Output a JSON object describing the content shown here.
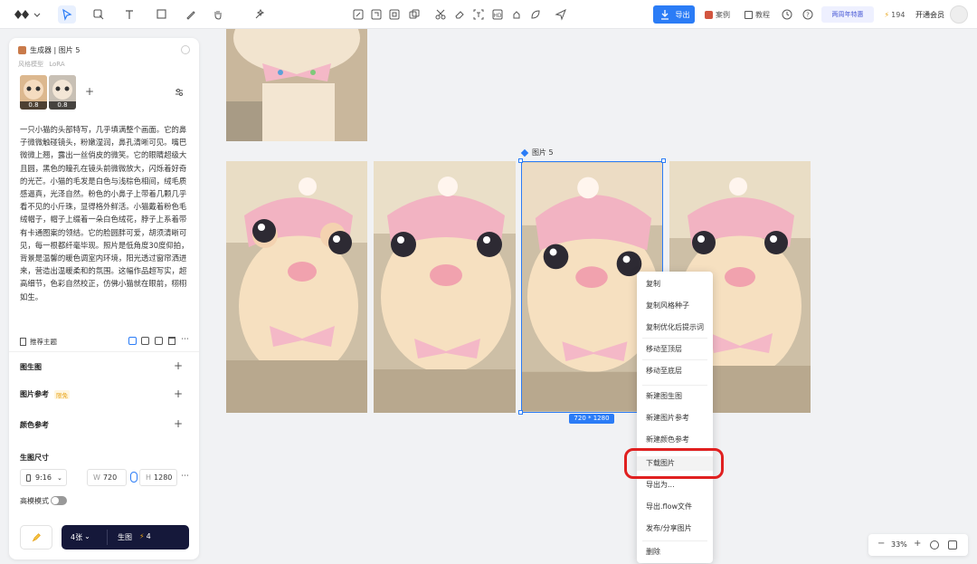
{
  "toolbar": {
    "export_label": "导出",
    "cases_label": "案例",
    "tutorial_label": "教程",
    "anniversary_label": "两周年特惠",
    "credits": "194",
    "membership_label": "开通会员"
  },
  "panel": {
    "title": "生成器 | 图片 5",
    "lora_label": "LoRA",
    "model_label": "风格模型",
    "ref_weights": [
      "0.8",
      "0.8"
    ],
    "prompt": "一只小猫的头部特写，几乎填满整个画面。它的鼻子微微触碰镜头，粉嫩湿润，鼻孔清晰可见。嘴巴微微上翘，露出一丝俏皮的微笑。它的眼睛超级大且圆，黑色的瞳孔在镜头前微微放大，闪烁着好奇的光芒。小猫的毛发是白色与浅棕色相间，绒毛质感逼真，光泽自然。粉色的小鼻子上带着几颗几乎看不见的小斤珠，显得格外鲜活。小猫戴着粉色毛绒帽子，帽子上缀着一朵白色绒花，脖子上系着带有卡通图案的领结。它的脸圆胖可爱，胡须清晰可见，每一根都纤毫毕现。照片是低角度30度仰拍，背景是温馨的暖色调室内环境，阳光透过窗帘洒进来，营造出温暖柔和的氛围。这幅作品超写实，超高细节，色彩自然校正，仿佛小猫就在眼前，栩栩如生。",
    "recommend_label": "推荐主题",
    "sections": [
      {
        "label": "图生图"
      },
      {
        "label": "图片参考",
        "badge": "限免"
      },
      {
        "label": "颜色参考"
      }
    ],
    "size_label": "生图尺寸",
    "ratio": "9:16",
    "width_prefix": "W",
    "width_value": "720",
    "height_prefix": "H",
    "height_value": "1280",
    "hd_label": "高模模式",
    "count_label": "4张",
    "generate_label": "生图",
    "generate_cost": "4"
  },
  "canvas": {
    "selected_label": "图片 5",
    "dimension_label": "720 * 1280",
    "zoom": "33%"
  },
  "context_menu": [
    {
      "label": "复制",
      "group": 1
    },
    {
      "label": "复制风格种子",
      "group": 1
    },
    {
      "label": "复制优化后提示词",
      "group": 1
    },
    {
      "label": "移动至顶层",
      "group": 2
    },
    {
      "label": "移动至底层",
      "group": 2
    },
    {
      "label": "新建图生图",
      "group": 3
    },
    {
      "label": "新建图片参考",
      "group": 3
    },
    {
      "label": "新建颜色参考",
      "group": 3
    },
    {
      "label": "下载图片",
      "group": 4
    },
    {
      "label": "导出为...",
      "group": 4
    },
    {
      "label": "导出.flow文件",
      "group": 4
    },
    {
      "label": "发布/分享图片",
      "group": 4
    },
    {
      "label": "删除",
      "group": 5
    }
  ],
  "colors": {
    "accent": "#2b7cf6",
    "highlight_ring": "#e02020",
    "generate_bg": "#15183a",
    "badge": "#e8a317"
  },
  "icons": [
    "logo-icon",
    "pointer-icon",
    "frame-icon",
    "text-icon",
    "shape-icon",
    "pen-icon",
    "hand-icon",
    "ai-icon",
    "edit-icon",
    "crop-icon",
    "expand-icon",
    "layers-icon",
    "scissors-icon",
    "eraser-icon",
    "text-recognize-icon",
    "upscale-icon",
    "redraw-icon",
    "style-icon",
    "send-icon",
    "download-icon",
    "history-icon",
    "help-icon",
    "bolt-icon"
  ]
}
